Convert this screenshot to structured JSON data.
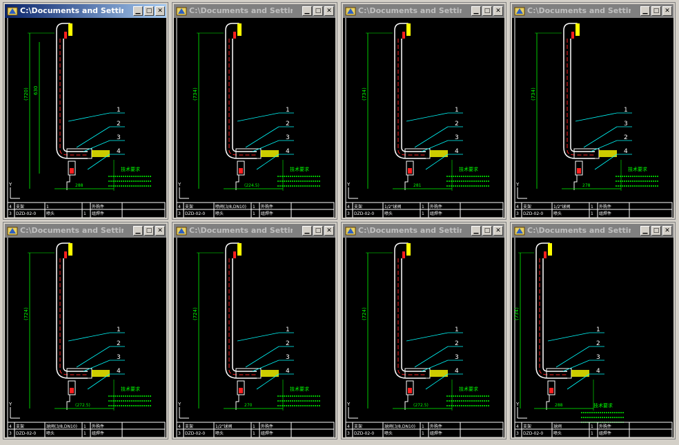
{
  "windows": [
    {
      "title": "C:\\Documents and Settings...",
      "active": true,
      "dim_v1": "(720)",
      "dim_v2": "630",
      "dim_h": "288",
      "callouts": [
        "1",
        "2",
        "3",
        "4"
      ],
      "notes_title": "技术要求",
      "rows": [
        [
          "4",
          "支架",
          "1",
          "",
          "外购件"
        ],
        [
          "3",
          "DZD-02-0",
          "喷头",
          "1",
          "组焊件"
        ]
      ]
    },
    {
      "title": "C:\\Documents and Settings",
      "active": false,
      "dim_v1": "(734)",
      "dim_v2": "",
      "dim_h": "(224.5)",
      "callouts": [
        "1",
        "2",
        "3",
        "4"
      ],
      "notes_title": "技术要求",
      "rows": [
        [
          "4",
          "支架",
          "喷阀(3/8,DN10)",
          "1",
          "外购件"
        ],
        [
          "3",
          "DZD-02-0",
          "喷头",
          "1",
          "组焊件"
        ]
      ]
    },
    {
      "title": "C:\\Documents and Settings",
      "active": false,
      "dim_v1": "(734)",
      "dim_v2": "",
      "dim_h": "281",
      "callouts": [
        "1",
        "2",
        "3",
        "4"
      ],
      "notes_title": "技术要求",
      "rows": [
        [
          "4",
          "支架",
          "1/2\"球阀",
          "1",
          "外购件"
        ],
        [
          "3",
          "DZD-02-0",
          "喷头",
          "1",
          "组焊件"
        ]
      ]
    },
    {
      "title": "C:\\Documents and Settings",
      "active": false,
      "dim_v1": "(734)",
      "dim_v2": "",
      "dim_h": "278",
      "callouts": [
        "1",
        "3",
        "2",
        "4"
      ],
      "notes_title": "技术要求",
      "rows": [
        [
          "4",
          "支架",
          "1/2\"球阀",
          "1",
          "外购件"
        ],
        [
          "3",
          "DZD-02-0",
          "喷头",
          "1",
          "组焊件"
        ]
      ]
    },
    {
      "title": "C:\\Documents and Settings",
      "active": false,
      "dim_v1": "(724)",
      "dim_v2": "",
      "dim_h": "(272.5)",
      "callouts": [
        "1",
        "2",
        "3",
        "4"
      ],
      "notes_title": "技术要求",
      "rows": [
        [
          "4",
          "支架",
          "球阀(3/8,DN10)",
          "1",
          "外购件"
        ],
        [
          "3",
          "DZD-02-0",
          "喷头",
          "1",
          "组焊件"
        ]
      ]
    },
    {
      "title": "C:\\Documents and Settings",
      "active": false,
      "dim_v1": "(724)",
      "dim_v2": "",
      "dim_h": "270",
      "callouts": [
        "1",
        "2",
        "3",
        "4"
      ],
      "notes_title": "技术要求",
      "rows": [
        [
          "4",
          "支架",
          "1/2\"球阀",
          "1",
          "外购件"
        ],
        [
          "3",
          "DZD-02-0",
          "喷头",
          "1",
          "组焊件"
        ]
      ]
    },
    {
      "title": "C:\\Documents and Settings",
      "active": false,
      "dim_v1": "(724)",
      "dim_v2": "",
      "dim_h": "(272.5)",
      "callouts": [
        "1",
        "2",
        "3",
        "4"
      ],
      "notes_title": "技术要求",
      "rows": [
        [
          "4",
          "支架",
          "球阀(3/8,DN10)",
          "1",
          "外购件"
        ],
        [
          "3",
          "DZD-02-0",
          "喷头",
          "1",
          "组焊件"
        ]
      ]
    },
    {
      "title": "C:\\Documents and Settings",
      "active": false,
      "dim_v1": "(734)",
      "dim_v2": "",
      "dim_h": "288",
      "callouts": [
        "1",
        "2",
        "3",
        "4"
      ],
      "notes_title": "技术要求",
      "rows": [
        [
          "4",
          "支架",
          "球阀",
          "1",
          "外购件"
        ],
        [
          "3",
          "DZD-02-0",
          "喷头",
          "1",
          "组焊件"
        ]
      ]
    }
  ],
  "colors": {
    "cad_bg": "#000000",
    "pipe": "#ffffff",
    "centerline": "#ff2020",
    "dim": "#00ff00",
    "callout": "#00ffff",
    "part": "#ffff00",
    "frame": "#ffffff"
  },
  "icons": {
    "app": "autocad-icon",
    "min": "minimize-icon",
    "max": "maximize-icon",
    "close": "close-icon",
    "ucs": "ucs-axis-icon"
  }
}
